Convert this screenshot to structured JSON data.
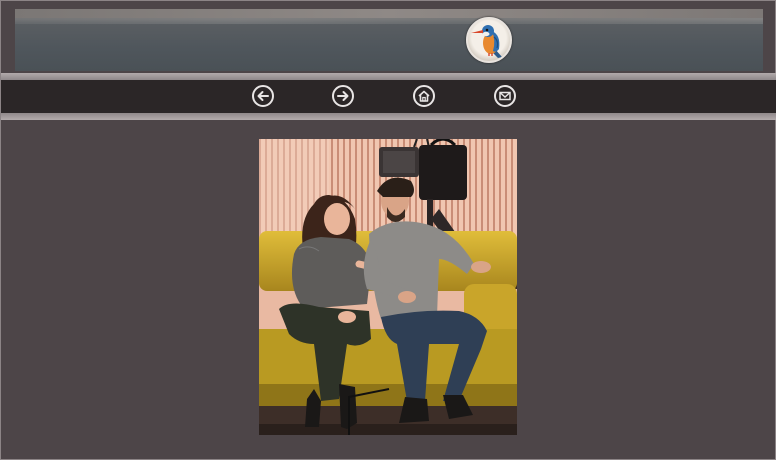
{
  "header": {
    "logo_icon": "kingfisher-bird-logo",
    "banner_image": "lake-shoreline-banner"
  },
  "nav": {
    "items": [
      {
        "id": "back",
        "icon": "arrow-left-icon"
      },
      {
        "id": "forward",
        "icon": "arrow-right-icon"
      },
      {
        "id": "home",
        "icon": "home-icon"
      },
      {
        "id": "mail",
        "icon": "envelope-icon"
      }
    ]
  },
  "main": {
    "photo": "two-actors-on-yellow-sofa-stage-scene"
  },
  "colors": {
    "page_bg": "#4d4548",
    "nav_bg": "#2b2627",
    "separator": "#b2aaab",
    "icon": "#e8e5e5"
  }
}
